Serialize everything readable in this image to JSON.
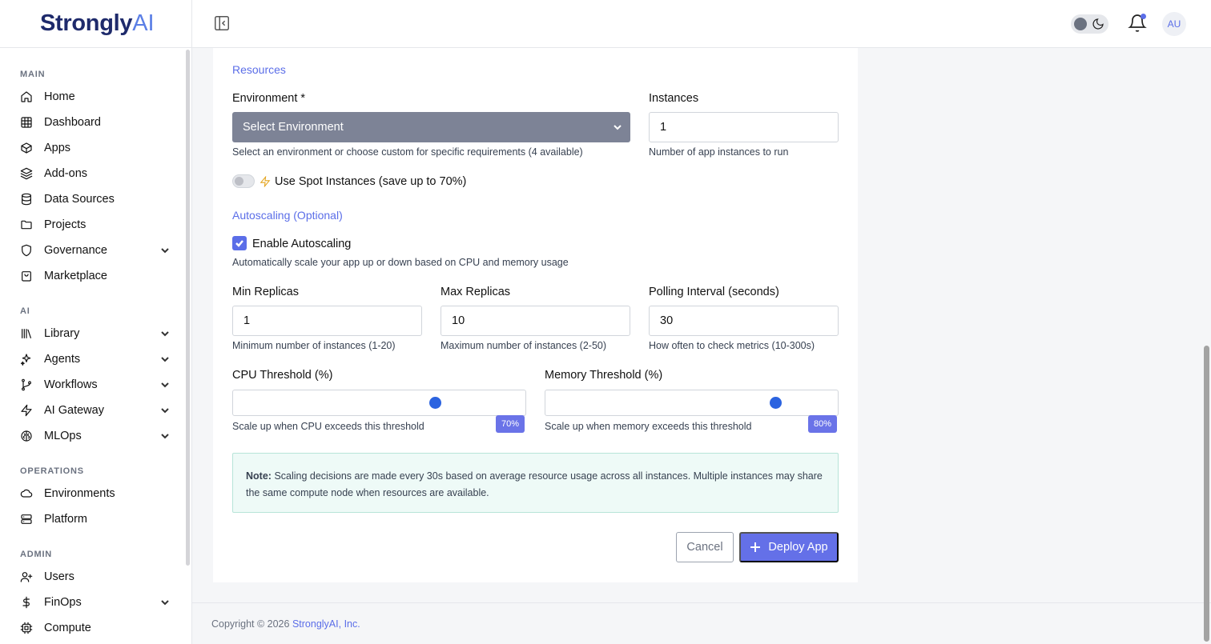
{
  "brand": {
    "name_bold": "Strongly",
    "name_light": "AI"
  },
  "sidebar": {
    "sections": [
      {
        "title": "MAIN",
        "items": [
          {
            "label": "Home",
            "icon": "home-icon"
          },
          {
            "label": "Dashboard",
            "icon": "grid-icon"
          },
          {
            "label": "Apps",
            "icon": "box-icon"
          },
          {
            "label": "Add-ons",
            "icon": "layers-icon"
          },
          {
            "label": "Data Sources",
            "icon": "database-icon"
          },
          {
            "label": "Projects",
            "icon": "folder-icon"
          },
          {
            "label": "Governance",
            "icon": "shield-icon",
            "expandable": true
          },
          {
            "label": "Marketplace",
            "icon": "shopping-bag-icon"
          }
        ]
      },
      {
        "title": "AI",
        "items": [
          {
            "label": "Library",
            "icon": "library-icon",
            "expandable": true
          },
          {
            "label": "Agents",
            "icon": "sparkles-icon",
            "expandable": true
          },
          {
            "label": "Workflows",
            "icon": "git-branch-icon",
            "expandable": true
          },
          {
            "label": "AI Gateway",
            "icon": "zap-icon",
            "expandable": true
          },
          {
            "label": "MLOps",
            "icon": "brain-icon",
            "expandable": true
          }
        ]
      },
      {
        "title": "OPERATIONS",
        "items": [
          {
            "label": "Environments",
            "icon": "cloud-icon"
          },
          {
            "label": "Platform",
            "icon": "server-icon"
          }
        ]
      },
      {
        "title": "ADMIN",
        "items": [
          {
            "label": "Users",
            "icon": "user-plus-icon"
          },
          {
            "label": "FinOps",
            "icon": "dollar-icon",
            "expandable": true
          },
          {
            "label": "Compute",
            "icon": "cpu-icon"
          }
        ]
      }
    ]
  },
  "header": {
    "avatar_initials": "AU",
    "notification_dot_color": "#5b6ee8"
  },
  "form": {
    "resources_title": "Resources",
    "environment": {
      "label": "Environment *",
      "value": "Select Environment",
      "hint": "Select an environment or choose custom for specific requirements (4 available)"
    },
    "instances": {
      "label": "Instances",
      "value": "1",
      "hint": "Number of app instances to run"
    },
    "spot": {
      "label": "Use Spot Instances (save up to 70%)",
      "enabled": false
    },
    "autoscaling_title": "Autoscaling (Optional)",
    "enable_autoscaling": {
      "label": "Enable Autoscaling",
      "checked": true,
      "hint": "Automatically scale your app up or down based on CPU and memory usage"
    },
    "min_replicas": {
      "label": "Min Replicas",
      "value": "1",
      "hint": "Minimum number of instances (1-20)"
    },
    "max_replicas": {
      "label": "Max Replicas",
      "value": "10",
      "hint": "Maximum number of instances (2-50)"
    },
    "polling_interval": {
      "label": "Polling Interval (seconds)",
      "value": "30",
      "hint": "How often to check metrics (10-300s)"
    },
    "cpu_threshold": {
      "label": "CPU Threshold (%)",
      "value": 70,
      "badge": "70%",
      "hint": "Scale up when CPU exceeds this threshold"
    },
    "memory_threshold": {
      "label": "Memory Threshold (%)",
      "value": 80,
      "badge": "80%",
      "hint": "Scale up when memory exceeds this threshold"
    },
    "note": {
      "bold": "Note:",
      "text": "Scaling decisions are made every 30s based on average resource usage across all instances. Multiple instances may share the same compute node when resources are available."
    },
    "cancel_label": "Cancel",
    "deploy_label": "Deploy App"
  },
  "footer": {
    "copyright": "Copyright © 2026",
    "company": "StronglyAI, Inc."
  },
  "colors": {
    "accent": "#5b6ee8",
    "brand_dark": "#1e2a6b",
    "slider_thumb": "#2b63e0"
  }
}
